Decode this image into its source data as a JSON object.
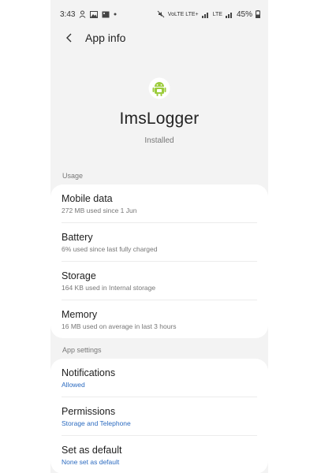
{
  "statusbar": {
    "time": "3:43",
    "battery": "45%",
    "net1": "VoLTE LTE+",
    "net2": "LTE"
  },
  "header": {
    "title": "App info"
  },
  "app": {
    "name": "ImsLogger",
    "status": "Installed"
  },
  "usage": {
    "label": "Usage",
    "items": [
      {
        "title": "Mobile data",
        "sub": "272 MB used since 1 Jun"
      },
      {
        "title": "Battery",
        "sub": "6% used since last fully charged"
      },
      {
        "title": "Storage",
        "sub": "164 KB used in Internal storage"
      },
      {
        "title": "Memory",
        "sub": "16 MB used on average in last 3 hours"
      }
    ]
  },
  "settings": {
    "label": "App settings",
    "items": [
      {
        "title": "Notifications",
        "sub": "Allowed"
      },
      {
        "title": "Permissions",
        "sub": "Storage and Telephone"
      },
      {
        "title": "Set as default",
        "sub": "None set as default"
      }
    ]
  },
  "colors": {
    "accent": "#2c6bc0",
    "android_green": "#9ccc3c"
  }
}
